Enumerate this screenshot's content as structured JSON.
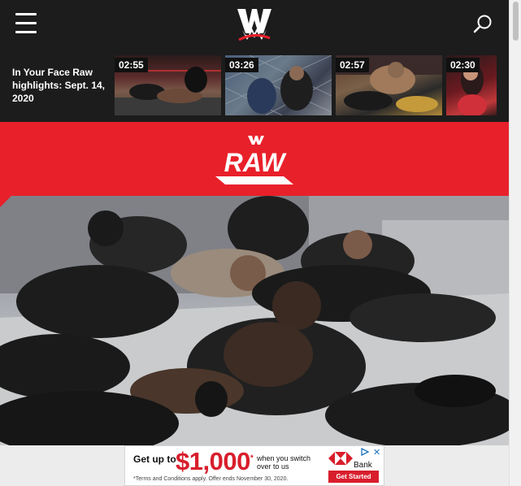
{
  "colors": {
    "nav_bg": "#1c1c1c",
    "brand_red": "#e8202a",
    "ad_red": "#d81e2c"
  },
  "header": {
    "menu_icon": "hamburger-menu-icon",
    "logo_icon": "wwe-logo-icon",
    "search_icon": "search-icon"
  },
  "video_strip": {
    "title": "In Your Face Raw highlights: Sept. 14, 2020",
    "videos": [
      {
        "duration": "02:55"
      },
      {
        "duration": "03:26"
      },
      {
        "duration": "02:57"
      },
      {
        "duration": "02:30"
      }
    ]
  },
  "banner": {
    "brand_icon": "wwe-logo-icon",
    "logo_text": "RAW"
  },
  "hero": {
    "image": "superstars-lying-on-floor-photo"
  },
  "ad": {
    "lead": "Get up to",
    "amount": "$1,000",
    "asterisk": "*",
    "sub": "when you switch over to us",
    "terms": "*Terms and Conditions apply. Offer ends November 30, 2020.",
    "bank": "Bank",
    "cta": "Get Started",
    "close": "✕"
  }
}
